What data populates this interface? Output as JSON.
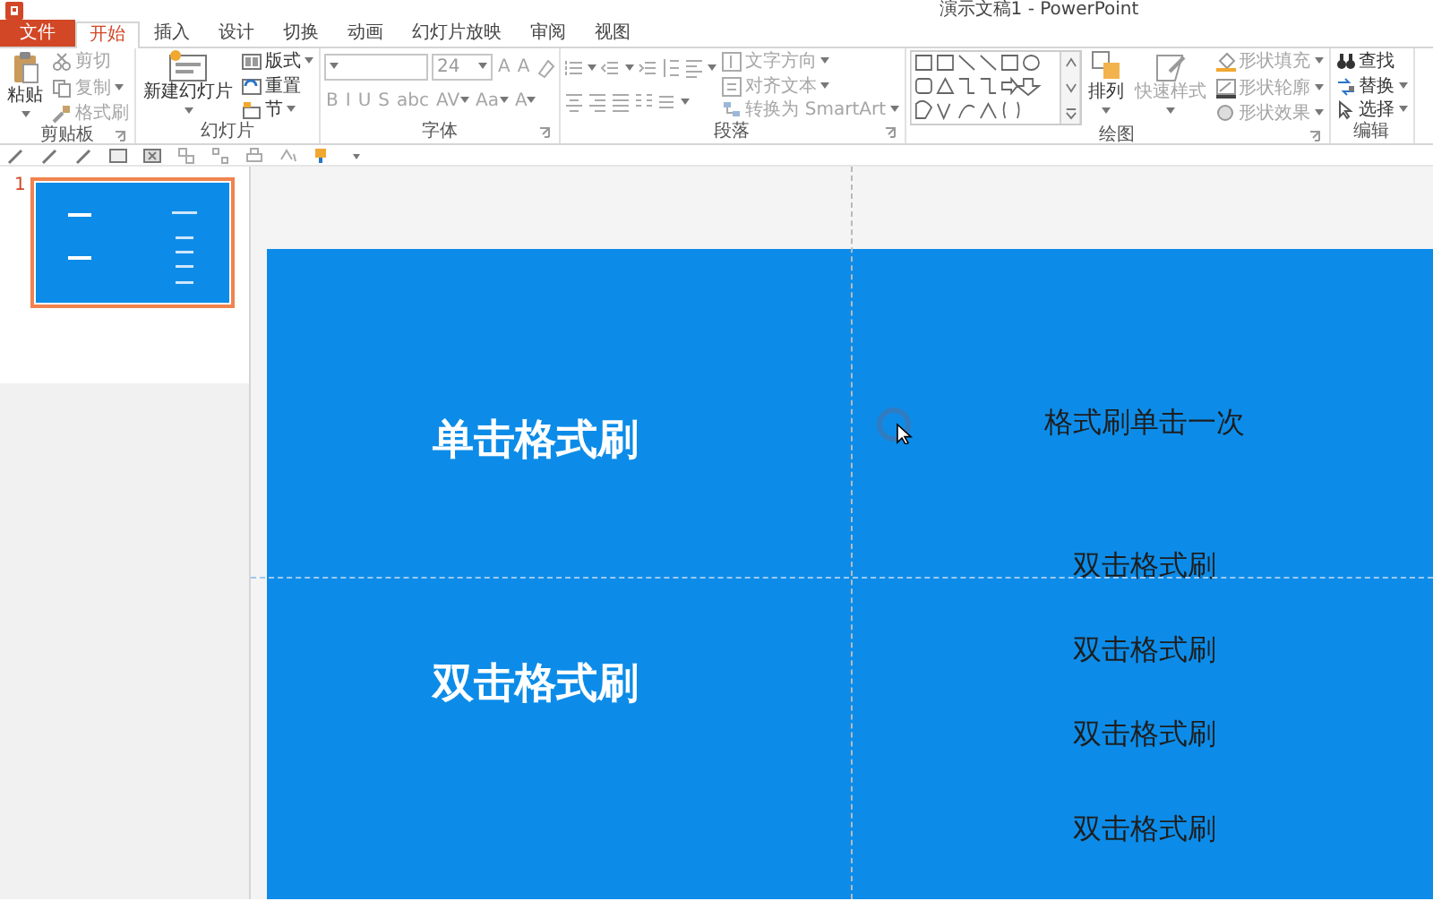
{
  "window": {
    "title": "演示文稿1 - PowerPoint"
  },
  "tabs": [
    {
      "label": "文件",
      "kind": "file",
      "selected": false
    },
    {
      "label": "开始",
      "kind": "tab",
      "selected": true
    },
    {
      "label": "插入",
      "kind": "tab",
      "selected": false
    },
    {
      "label": "设计",
      "kind": "tab",
      "selected": false
    },
    {
      "label": "切换",
      "kind": "tab",
      "selected": false
    },
    {
      "label": "动画",
      "kind": "tab",
      "selected": false
    },
    {
      "label": "幻灯片放映",
      "kind": "tab",
      "selected": false
    },
    {
      "label": "审阅",
      "kind": "tab",
      "selected": false
    },
    {
      "label": "视图",
      "kind": "tab",
      "selected": false
    }
  ],
  "ribbon": {
    "groups": [
      {
        "label": "剪贴板",
        "launcher": true,
        "columns": [
          [
            {
              "kind": "large",
              "label": "粘贴",
              "dropdown": true,
              "disabled": false
            }
          ],
          [
            {
              "kind": "small",
              "label": "剪切",
              "disabled": true
            },
            {
              "kind": "small",
              "label": "复制",
              "dropdown": true,
              "disabled": true
            },
            {
              "kind": "small",
              "label": "格式刷",
              "disabled": true
            }
          ]
        ]
      },
      {
        "label": "幻灯片",
        "launcher": false,
        "columns": [
          [
            {
              "kind": "large",
              "label": "新建幻灯片",
              "dropdown": true,
              "disabled": false
            }
          ],
          [
            {
              "kind": "small",
              "label": "版式",
              "dropdown": true,
              "disabled": false
            },
            {
              "kind": "small",
              "label": "重置",
              "disabled": false
            },
            {
              "kind": "small",
              "label": "节",
              "dropdown": true,
              "disabled": false
            }
          ]
        ]
      },
      {
        "label": "字体",
        "launcher": true,
        "columns": [
          [
            {
              "kind": "line",
              "parts": [
                {
                  "kind": "combo"
                },
                {
                  "kind": "combo",
                  "value": "24"
                },
                {
                  "kind": "glyph",
                  "text": "A",
                  "disabled": true
                },
                {
                  "kind": "glyph",
                  "text": "A",
                  "disabled": true
                },
                {
                  "kind": "icon",
                  "disabled": true
                }
              ]
            },
            {
              "kind": "line",
              "parts": [
                {
                  "kind": "glyph",
                  "text": "B",
                  "disabled": true
                },
                {
                  "kind": "glyph",
                  "text": "I",
                  "disabled": true
                },
                {
                  "kind": "glyph",
                  "text": "U",
                  "disabled": true
                },
                {
                  "kind": "glyph",
                  "text": "S",
                  "disabled": true
                },
                {
                  "kind": "glyph",
                  "text": "abc",
                  "disabled": true
                },
                {
                  "kind": "glyph",
                  "text": "AV",
                  "dropdown": true,
                  "disabled": true
                },
                {
                  "kind": "glyph",
                  "text": "Aa",
                  "dropdown": true,
                  "disabled": true
                },
                {
                  "kind": "glyph",
                  "text": "A",
                  "dropdown": true,
                  "disabled": true
                }
              ]
            }
          ]
        ]
      },
      {
        "label": "段落",
        "launcher": true,
        "columns": [
          [
            {
              "kind": "line",
              "parts": [
                {
                  "kind": "icon",
                  "dropdown": true,
                  "disabled": true
                },
                {
                  "kind": "icon",
                  "dropdown": true,
                  "disabled": true
                },
                {
                  "kind": "icon",
                  "disabled": true
                },
                {
                  "kind": "icon",
                  "disabled": true
                },
                {
                  "kind": "icon",
                  "dropdown": true,
                  "disabled": true
                }
              ]
            },
            {
              "kind": "line",
              "parts": [
                {
                  "kind": "icon",
                  "disabled": true
                },
                {
                  "kind": "icon",
                  "disabled": true
                },
                {
                  "kind": "icon",
                  "disabled": true
                },
                {
                  "kind": "icon",
                  "disabled": true
                },
                {
                  "kind": "icon",
                  "dropdown": true,
                  "disabled": true
                }
              ]
            }
          ],
          [
            {
              "kind": "small",
              "label": "文字方向",
              "dropdown": true,
              "disabled": true
            },
            {
              "kind": "small",
              "label": "对齐文本",
              "dropdown": true,
              "disabled": true
            },
            {
              "kind": "small",
              "label": "转换为 SmartArt",
              "dropdown": true,
              "disabled": true
            }
          ]
        ]
      },
      {
        "label": "绘图",
        "launcher": true,
        "columns": [
          [
            {
              "kind": "gallery"
            }
          ],
          [
            {
              "kind": "large",
              "label": "排列",
              "dropdown": true,
              "disabled": false
            }
          ],
          [
            {
              "kind": "large",
              "label": "快速样式",
              "dropdown": true,
              "disabled": true
            }
          ],
          [
            {
              "kind": "small",
              "label": "形状填充",
              "dropdown": true,
              "disabled": true
            },
            {
              "kind": "small",
              "label": "形状轮廓",
              "dropdown": true,
              "disabled": true
            },
            {
              "kind": "small",
              "label": "形状效果",
              "dropdown": true,
              "disabled": true
            }
          ]
        ]
      },
      {
        "label": "编辑",
        "launcher": false,
        "columns": [
          [
            {
              "kind": "small",
              "label": "查找",
              "disabled": false
            },
            {
              "kind": "small",
              "label": "替换",
              "dropdown": true,
              "disabled": false
            },
            {
              "kind": "small",
              "label": "选择",
              "dropdown": true,
              "disabled": false
            }
          ]
        ]
      }
    ]
  },
  "thumbnails": [
    {
      "number": "1",
      "selected": true
    }
  ],
  "slide": {
    "text_boxes": [
      {
        "text": "单击格式刷",
        "kind": "title"
      },
      {
        "text": "双击格式刷",
        "kind": "title"
      },
      {
        "text": "格式刷单击一次",
        "kind": "body"
      },
      {
        "text": "双击格式刷",
        "kind": "body"
      },
      {
        "text": "双击格式刷",
        "kind": "body"
      },
      {
        "text": "双击格式刷",
        "kind": "body"
      },
      {
        "text": "双击格式刷",
        "kind": "body"
      }
    ]
  }
}
